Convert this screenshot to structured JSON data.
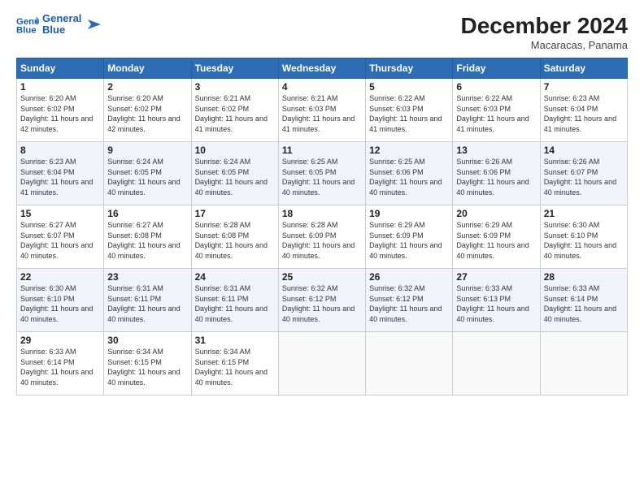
{
  "header": {
    "logo_line1": "General",
    "logo_line2": "Blue",
    "month": "December 2024",
    "location": "Macaracas, Panama"
  },
  "weekdays": [
    "Sunday",
    "Monday",
    "Tuesday",
    "Wednesday",
    "Thursday",
    "Friday",
    "Saturday"
  ],
  "weeks": [
    [
      {
        "day": "1",
        "sunrise": "6:20 AM",
        "sunset": "6:02 PM",
        "daylight": "11 hours and 42 minutes."
      },
      {
        "day": "2",
        "sunrise": "6:20 AM",
        "sunset": "6:02 PM",
        "daylight": "11 hours and 42 minutes."
      },
      {
        "day": "3",
        "sunrise": "6:21 AM",
        "sunset": "6:02 PM",
        "daylight": "11 hours and 41 minutes."
      },
      {
        "day": "4",
        "sunrise": "6:21 AM",
        "sunset": "6:03 PM",
        "daylight": "11 hours and 41 minutes."
      },
      {
        "day": "5",
        "sunrise": "6:22 AM",
        "sunset": "6:03 PM",
        "daylight": "11 hours and 41 minutes."
      },
      {
        "day": "6",
        "sunrise": "6:22 AM",
        "sunset": "6:03 PM",
        "daylight": "11 hours and 41 minutes."
      },
      {
        "day": "7",
        "sunrise": "6:23 AM",
        "sunset": "6:04 PM",
        "daylight": "11 hours and 41 minutes."
      }
    ],
    [
      {
        "day": "8",
        "sunrise": "6:23 AM",
        "sunset": "6:04 PM",
        "daylight": "11 hours and 41 minutes."
      },
      {
        "day": "9",
        "sunrise": "6:24 AM",
        "sunset": "6:05 PM",
        "daylight": "11 hours and 40 minutes."
      },
      {
        "day": "10",
        "sunrise": "6:24 AM",
        "sunset": "6:05 PM",
        "daylight": "11 hours and 40 minutes."
      },
      {
        "day": "11",
        "sunrise": "6:25 AM",
        "sunset": "6:05 PM",
        "daylight": "11 hours and 40 minutes."
      },
      {
        "day": "12",
        "sunrise": "6:25 AM",
        "sunset": "6:06 PM",
        "daylight": "11 hours and 40 minutes."
      },
      {
        "day": "13",
        "sunrise": "6:26 AM",
        "sunset": "6:06 PM",
        "daylight": "11 hours and 40 minutes."
      },
      {
        "day": "14",
        "sunrise": "6:26 AM",
        "sunset": "6:07 PM",
        "daylight": "11 hours and 40 minutes."
      }
    ],
    [
      {
        "day": "15",
        "sunrise": "6:27 AM",
        "sunset": "6:07 PM",
        "daylight": "11 hours and 40 minutes."
      },
      {
        "day": "16",
        "sunrise": "6:27 AM",
        "sunset": "6:08 PM",
        "daylight": "11 hours and 40 minutes."
      },
      {
        "day": "17",
        "sunrise": "6:28 AM",
        "sunset": "6:08 PM",
        "daylight": "11 hours and 40 minutes."
      },
      {
        "day": "18",
        "sunrise": "6:28 AM",
        "sunset": "6:09 PM",
        "daylight": "11 hours and 40 minutes."
      },
      {
        "day": "19",
        "sunrise": "6:29 AM",
        "sunset": "6:09 PM",
        "daylight": "11 hours and 40 minutes."
      },
      {
        "day": "20",
        "sunrise": "6:29 AM",
        "sunset": "6:09 PM",
        "daylight": "11 hours and 40 minutes."
      },
      {
        "day": "21",
        "sunrise": "6:30 AM",
        "sunset": "6:10 PM",
        "daylight": "11 hours and 40 minutes."
      }
    ],
    [
      {
        "day": "22",
        "sunrise": "6:30 AM",
        "sunset": "6:10 PM",
        "daylight": "11 hours and 40 minutes."
      },
      {
        "day": "23",
        "sunrise": "6:31 AM",
        "sunset": "6:11 PM",
        "daylight": "11 hours and 40 minutes."
      },
      {
        "day": "24",
        "sunrise": "6:31 AM",
        "sunset": "6:11 PM",
        "daylight": "11 hours and 40 minutes."
      },
      {
        "day": "25",
        "sunrise": "6:32 AM",
        "sunset": "6:12 PM",
        "daylight": "11 hours and 40 minutes."
      },
      {
        "day": "26",
        "sunrise": "6:32 AM",
        "sunset": "6:12 PM",
        "daylight": "11 hours and 40 minutes."
      },
      {
        "day": "27",
        "sunrise": "6:33 AM",
        "sunset": "6:13 PM",
        "daylight": "11 hours and 40 minutes."
      },
      {
        "day": "28",
        "sunrise": "6:33 AM",
        "sunset": "6:14 PM",
        "daylight": "11 hours and 40 minutes."
      }
    ],
    [
      {
        "day": "29",
        "sunrise": "6:33 AM",
        "sunset": "6:14 PM",
        "daylight": "11 hours and 40 minutes."
      },
      {
        "day": "30",
        "sunrise": "6:34 AM",
        "sunset": "6:15 PM",
        "daylight": "11 hours and 40 minutes."
      },
      {
        "day": "31",
        "sunrise": "6:34 AM",
        "sunset": "6:15 PM",
        "daylight": "11 hours and 40 minutes."
      },
      null,
      null,
      null,
      null
    ]
  ]
}
